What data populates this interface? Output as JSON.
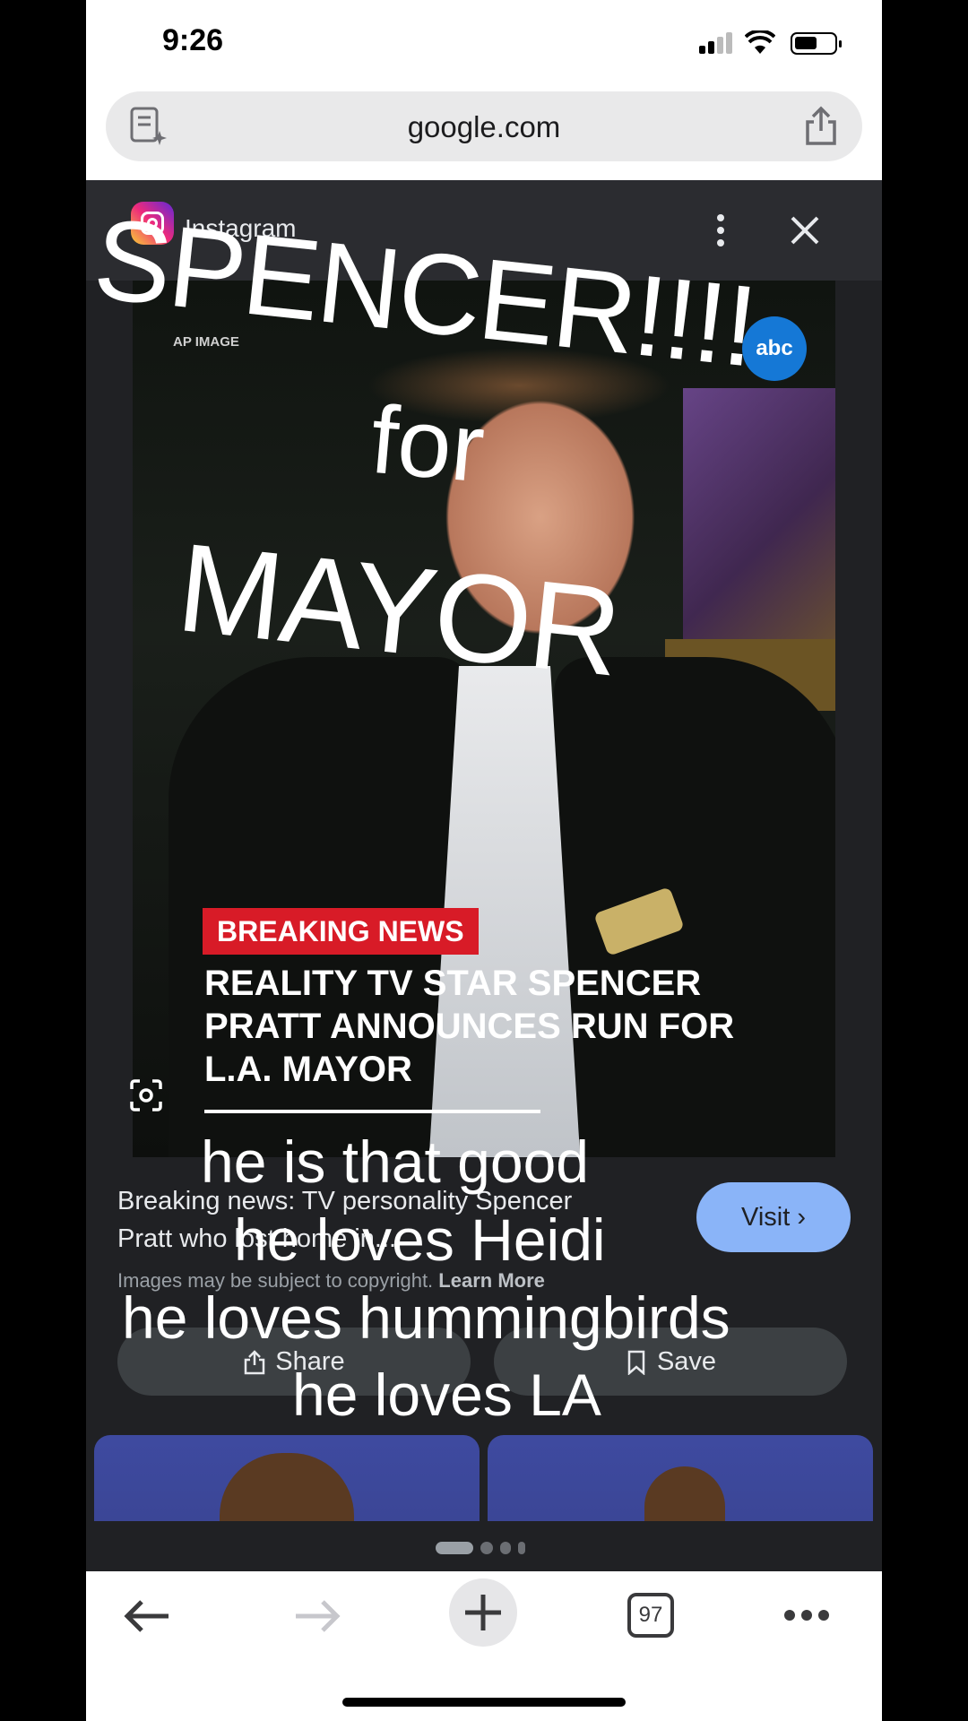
{
  "status_bar": {
    "time": "9:26"
  },
  "url_bar": {
    "url": "google.com"
  },
  "viewer": {
    "source": "Instagram",
    "photo": {
      "ap_label": "AP IMAGE",
      "abc_logo": "abc",
      "breaking_label": "BREAKING NEWS",
      "headline": "REALITY TV STAR SPENCER PRATT ANNOUNCES RUN FOR L.A. MAYOR"
    },
    "title": "Breaking news: TV personality Spencer Pratt who lost home in...",
    "visit_label": "Visit",
    "copyright_text": "Images may be subject to copyright.",
    "learn_more": "Learn More",
    "share_label": "Share",
    "save_label": "Save"
  },
  "toolbar": {
    "tab_count": "97"
  },
  "overlay": {
    "line1": "SPENCER!!!!",
    "line2": "for",
    "line3": "MAYOR",
    "captions": [
      "he is that good",
      "he loves Heidi",
      "he loves hummingbirds",
      "he loves LA"
    ]
  },
  "colors": {
    "visit_button": "#8ab4f8",
    "breaking_red": "#d81b27",
    "viewer_bg": "#202124"
  }
}
